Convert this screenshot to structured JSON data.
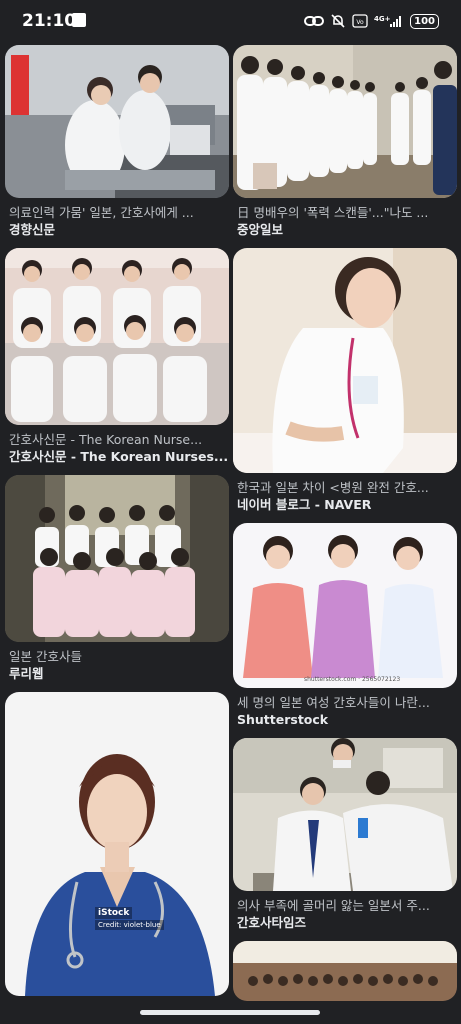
{
  "status_bar": {
    "time": "21:10",
    "battery": "100"
  },
  "results": [
    {
      "caption": "의료인력 가뭄' 일본, 간호사에게 ...",
      "source": "경향신문"
    },
    {
      "caption": "日 명배우의 '폭력 스캔들'...\"나도 ...",
      "source": "중앙일보"
    },
    {
      "caption": "간호사신문 - The Korean Nurse...",
      "source": "간호사신문 - The Korean Nurses..."
    },
    {
      "caption": "한국과 일본 차이 <병원 완전 간호...",
      "source": "네이버 블로그 - NAVER"
    },
    {
      "caption": "일본 간호사들",
      "source": "루리웹"
    },
    {
      "caption": "세 명의 일본 여성 간호사들이 나란...",
      "source": "Shutterstock"
    },
    {
      "caption": "",
      "source": ""
    },
    {
      "caption": "의사 부족에 골머리 앓는 일본서 주...",
      "source": "간호사타임즈"
    }
  ],
  "watermarks": {
    "shutterstock": "shutterstock.com · 2565072123",
    "istock": "iStock",
    "istock_credit": "Credit: violet-blue"
  },
  "colors": {
    "background": "#202124",
    "caption": "#bdc1c6",
    "source": "#e8eaed"
  }
}
